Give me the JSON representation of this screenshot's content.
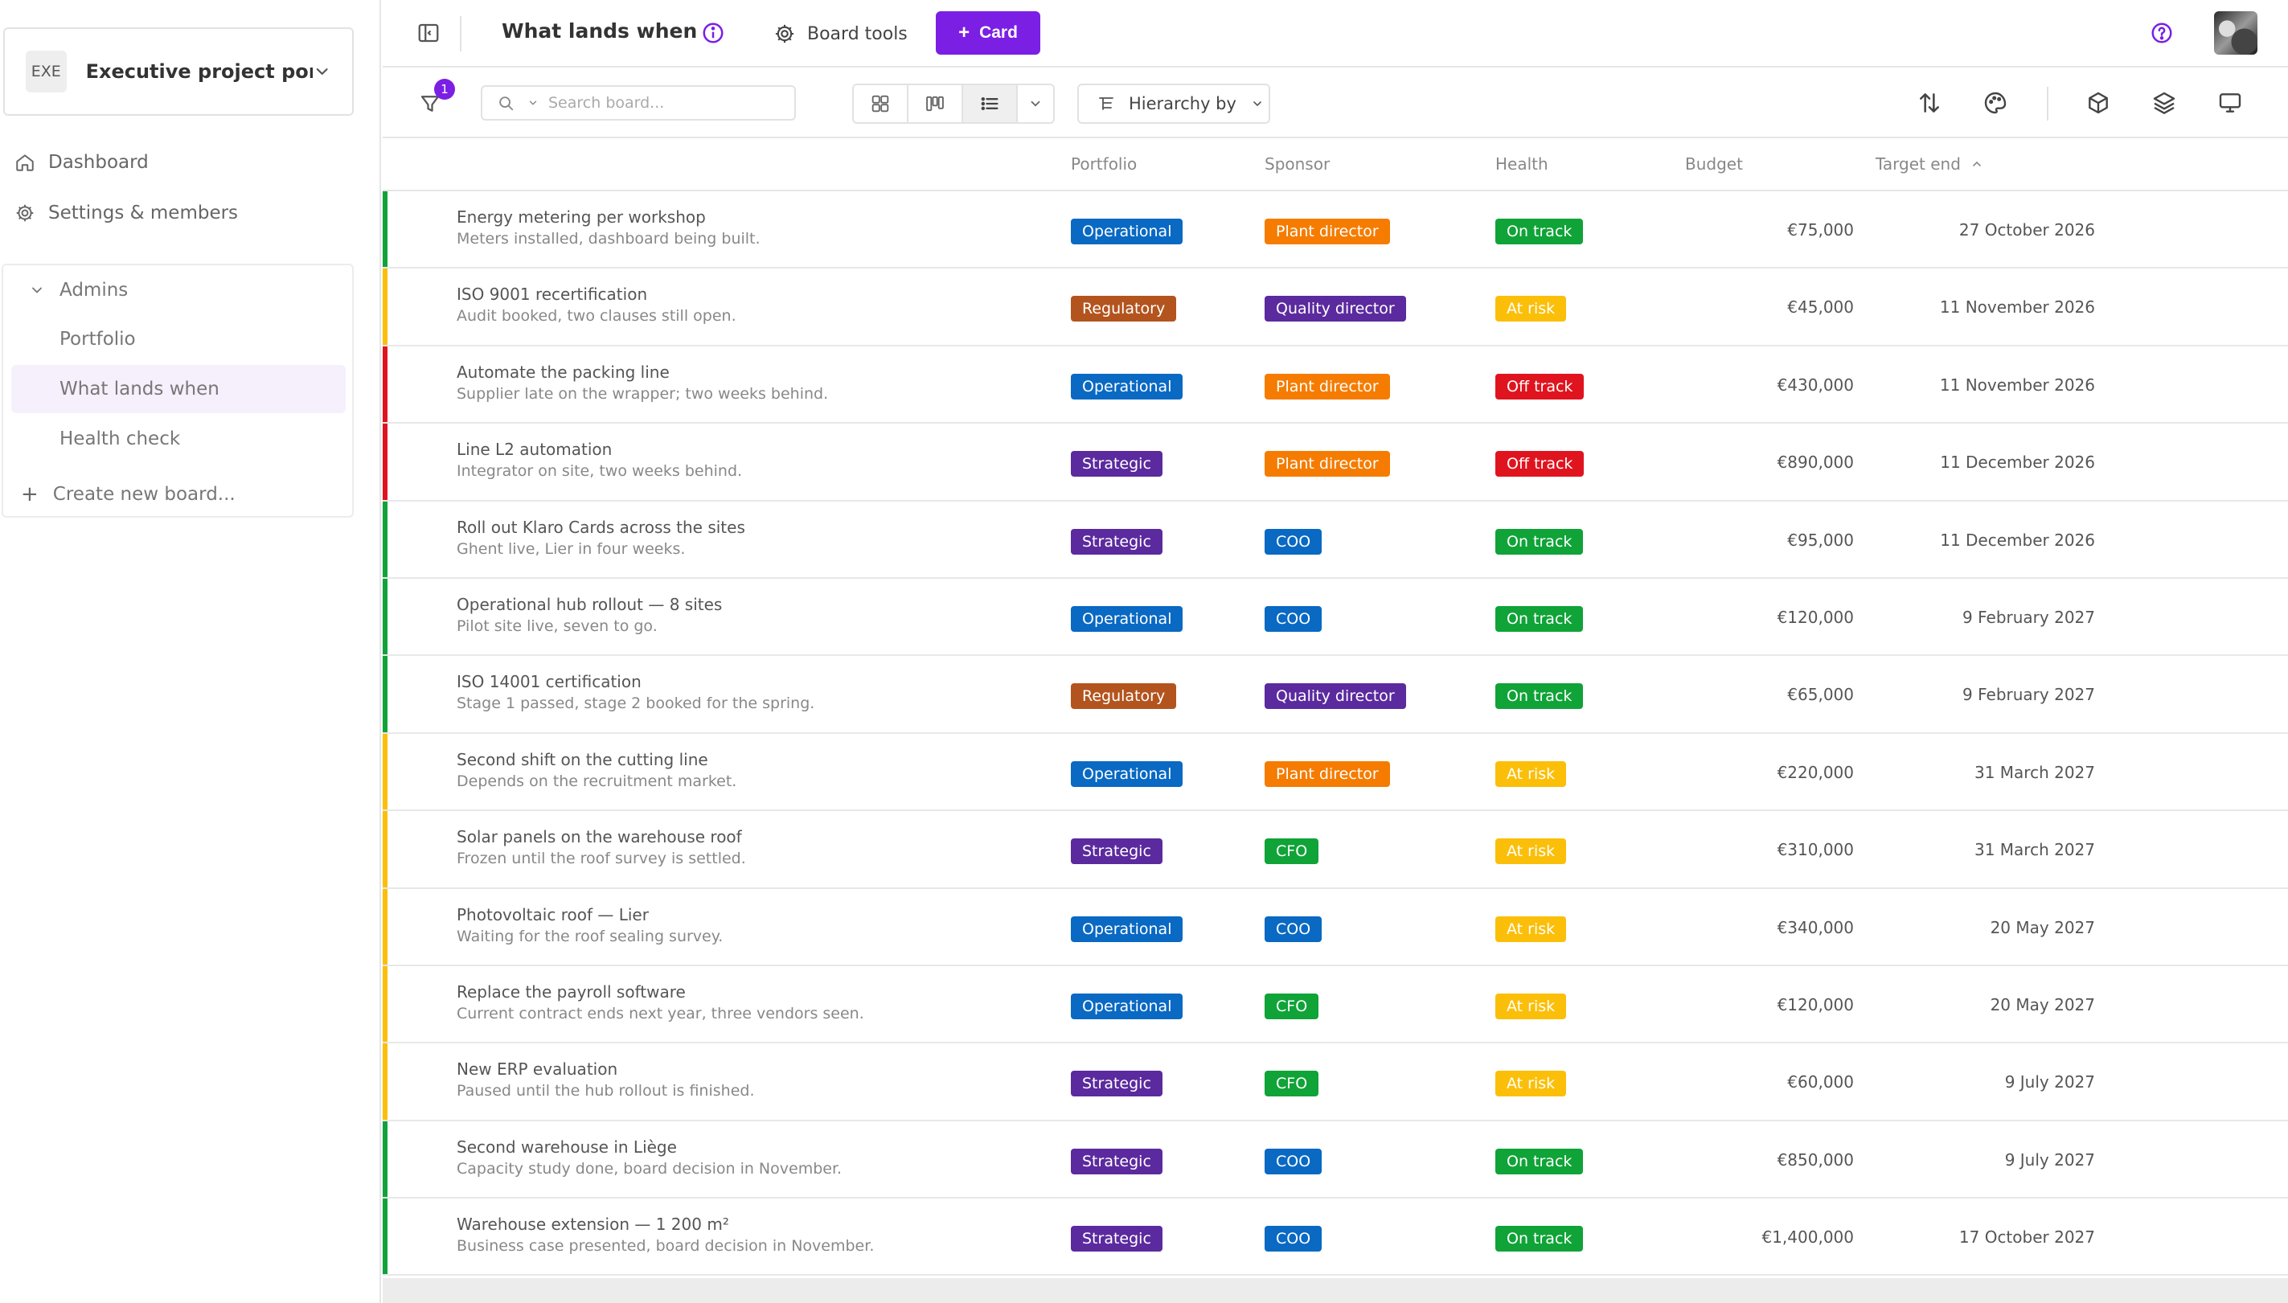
{
  "workspace": {
    "badge": "EXE",
    "name": "Executive project por..."
  },
  "nav": {
    "dashboard": "Dashboard",
    "settings": "Settings & members"
  },
  "boards": {
    "group": "Admins",
    "items": [
      "Portfolio",
      "What lands when",
      "Health check"
    ],
    "active": "What lands when",
    "create": "Create new board..."
  },
  "topbar": {
    "title": "What lands when",
    "board_tools": "Board tools",
    "card_button": "Card"
  },
  "toolbar": {
    "filter_count": "1",
    "search_placeholder": "Search board...",
    "hierarchy": "Hierarchy by"
  },
  "columns": {
    "portfolio": "Portfolio",
    "sponsor": "Sponsor",
    "health": "Health",
    "budget": "Budget",
    "target_end": "Target end"
  },
  "colors": {
    "accent": "#7b1fe4",
    "Operational": "#0969c3",
    "Regulatory": "#b3541e",
    "Strategic": "#5b2a9e",
    "Plant director": "#f57c00",
    "Quality director": "#5b2a9e",
    "COO": "#0969c3",
    "CFO": "#10a338",
    "On track": "#10a338",
    "At risk": "#fbbf0a",
    "Off track": "#e0141e"
  },
  "rows": [
    {
      "title": "Energy metering per workshop",
      "sub": "Meters installed, dashboard being built.",
      "portfolio": "Operational",
      "sponsor": "Plant director",
      "health": "On track",
      "budget": "€75,000",
      "target": "27 October 2026"
    },
    {
      "title": "ISO 9001 recertification",
      "sub": "Audit booked, two clauses still open.",
      "portfolio": "Regulatory",
      "sponsor": "Quality director",
      "health": "At risk",
      "budget": "€45,000",
      "target": "11 November 2026"
    },
    {
      "title": "Automate the packing line",
      "sub": "Supplier late on the wrapper; two weeks behind.",
      "portfolio": "Operational",
      "sponsor": "Plant director",
      "health": "Off track",
      "budget": "€430,000",
      "target": "11 November 2026"
    },
    {
      "title": "Line L2 automation",
      "sub": "Integrator on site, two weeks behind.",
      "portfolio": "Strategic",
      "sponsor": "Plant director",
      "health": "Off track",
      "budget": "€890,000",
      "target": "11 December 2026"
    },
    {
      "title": "Roll out Klaro Cards across the sites",
      "sub": "Ghent live, Lier in four weeks.",
      "portfolio": "Strategic",
      "sponsor": "COO",
      "health": "On track",
      "budget": "€95,000",
      "target": "11 December 2026"
    },
    {
      "title": "Operational hub rollout — 8 sites",
      "sub": "Pilot site live, seven to go.",
      "portfolio": "Operational",
      "sponsor": "COO",
      "health": "On track",
      "budget": "€120,000",
      "target": "9 February 2027"
    },
    {
      "title": "ISO 14001 certification",
      "sub": "Stage 1 passed, stage 2 booked for the spring.",
      "portfolio": "Regulatory",
      "sponsor": "Quality director",
      "health": "On track",
      "budget": "€65,000",
      "target": "9 February 2027"
    },
    {
      "title": "Second shift on the cutting line",
      "sub": "Depends on the recruitment market.",
      "portfolio": "Operational",
      "sponsor": "Plant director",
      "health": "At risk",
      "budget": "€220,000",
      "target": "31 March 2027"
    },
    {
      "title": "Solar panels on the warehouse roof",
      "sub": "Frozen until the roof survey is settled.",
      "portfolio": "Strategic",
      "sponsor": "CFO",
      "health": "At risk",
      "budget": "€310,000",
      "target": "31 March 2027"
    },
    {
      "title": "Photovoltaic roof — Lier",
      "sub": "Waiting for the roof sealing survey.",
      "portfolio": "Operational",
      "sponsor": "COO",
      "health": "At risk",
      "budget": "€340,000",
      "target": "20 May 2027"
    },
    {
      "title": "Replace the payroll software",
      "sub": "Current contract ends next year, three vendors seen.",
      "portfolio": "Operational",
      "sponsor": "CFO",
      "health": "At risk",
      "budget": "€120,000",
      "target": "20 May 2027"
    },
    {
      "title": "New ERP evaluation",
      "sub": "Paused until the hub rollout is finished.",
      "portfolio": "Strategic",
      "sponsor": "CFO",
      "health": "At risk",
      "budget": "€60,000",
      "target": "9 July 2027"
    },
    {
      "title": "Second warehouse in Liège",
      "sub": "Capacity study done, board decision in November.",
      "portfolio": "Strategic",
      "sponsor": "COO",
      "health": "On track",
      "budget": "€850,000",
      "target": "9 July 2027"
    },
    {
      "title": "Warehouse extension — 1 200 m²",
      "sub": "Business case presented, board decision in November.",
      "portfolio": "Strategic",
      "sponsor": "COO",
      "health": "On track",
      "budget": "€1,400,000",
      "target": "17 October 2027"
    }
  ]
}
